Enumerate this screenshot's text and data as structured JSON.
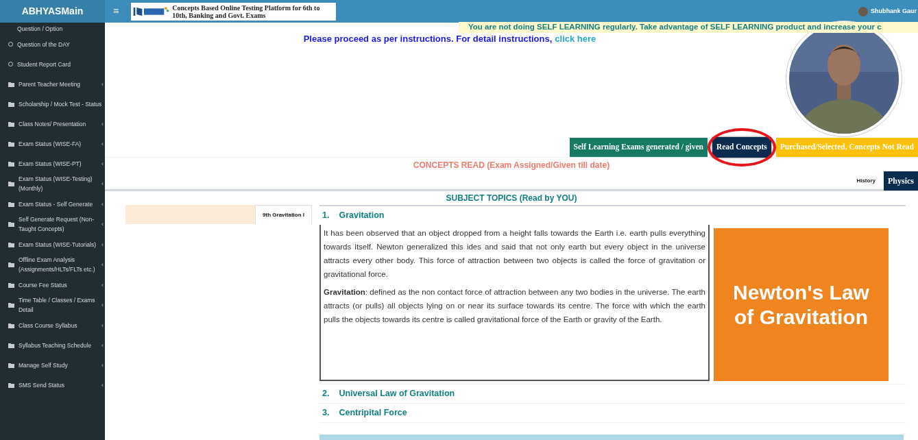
{
  "brand": {
    "title": "ABHYASMain"
  },
  "header": {
    "menu_toggle": "≡",
    "logo_tagline": "Concepts Based Online Testing Platform for 6th to 10th, Banking and Govt. Exams",
    "user": "Shubhank Gaur"
  },
  "sidebar": {
    "items": [
      {
        "label": "Question / Option",
        "kind": "plain"
      },
      {
        "label": "Question of the DAY",
        "kind": "circle"
      },
      {
        "label": "Student Report Card",
        "kind": "circle"
      },
      {
        "label": "Parent Teacher Meeting",
        "kind": "folder",
        "chevron": "‹"
      },
      {
        "label": "Scholarship / Mock Test - Status",
        "kind": "folder"
      },
      {
        "label": "Class Notes/ Presentation",
        "kind": "folder",
        "chevron": "‹"
      },
      {
        "label": "Exam Status (WISE-FA)",
        "kind": "folder",
        "chevron": "‹"
      },
      {
        "label": "Exam Status (WISE-PT)",
        "kind": "folder",
        "chevron": "‹"
      },
      {
        "label": "Exam Status (WISE-Testing) (Monthly)",
        "kind": "folder",
        "chevron": "‹"
      },
      {
        "label": "Exam Status - Self Generate",
        "kind": "folder",
        "chevron": "‹"
      },
      {
        "label": "Self Generate Request (Non-Taught Concepts)",
        "kind": "folder",
        "chevron": "‹"
      },
      {
        "label": "Exam Status (WISE-Tutorials)",
        "kind": "folder",
        "chevron": "‹"
      },
      {
        "label": "Offline Exam Analysis (Assignments/HLTs/FLTs etc.)",
        "kind": "folder",
        "chevron": "‹"
      },
      {
        "label": "Course Fee Status",
        "kind": "folder",
        "chevron": "‹"
      },
      {
        "label": "Time Table / Classes / Exams Detail",
        "kind": "folder",
        "chevron": "‹"
      },
      {
        "label": "Class Course Syllabus",
        "kind": "folder",
        "chevron": "‹"
      },
      {
        "label": "Syllabus Teaching Schedule",
        "kind": "folder",
        "chevron": "‹"
      },
      {
        "label": "Manage Self Study",
        "kind": "folder",
        "chevron": "‹"
      },
      {
        "label": "SMS Send Status",
        "kind": "folder",
        "chevron": "‹"
      }
    ]
  },
  "notice": "You are not doing **SELF LEARNING** regularly. Take advantage of **SELF LEARNING** product and increase your c",
  "instructions": {
    "text": "Please proceed as per instructions. For detail instructions,",
    "link": "click here"
  },
  "status_tabs": [
    {
      "label": "Self Learning Exams generated / given",
      "color": "#167a62",
      "selected": false
    },
    {
      "label": "Read Concepts",
      "color": "#0b2c4f",
      "selected": true
    },
    {
      "label": "Purchased/Selected, Concepts Not Read",
      "color": "#ffc107",
      "selected": false
    }
  ],
  "concepts_heading": "CONCEPTS READ (Exam Assigned/Given till date)",
  "subject_tabs": [
    {
      "label": "History",
      "selected": false
    },
    {
      "label": "Physics",
      "selected": true
    }
  ],
  "topics_heading": "SUBJECT TOPICS (Read by YOU)",
  "chapter_tabs": [
    {
      "label": "9th Gravitation I",
      "selected": true
    }
  ],
  "topics": [
    {
      "number": "1.",
      "title": "Gravitation",
      "expanded": true,
      "paragraphs": [
        "It has been observed that an object dropped from a height falls towards the Earth i.e. earth pulls everything towards itself. Newton generalized this ides and said that not only earth but every object in the universe attracts every other body. This force of attraction between two objects is called the force of gravitation or gravitational force.",
        "**Gravitation**: defined as the non contact force of attraction between any two bodies in the universe. The earth attracts (or pulls) all objects lying on or near its surface towards its centre. The force with which the earth pulls the objects towards its centre is called gravitational force of the Earth or gravity of the Earth."
      ],
      "image_caption": "Newton's Law of Gravitation"
    },
    {
      "number": "2.",
      "title": "Universal Law of Gravitation",
      "expanded": false
    },
    {
      "number": "3.",
      "title": "Centripital Force",
      "expanded": false
    }
  ]
}
